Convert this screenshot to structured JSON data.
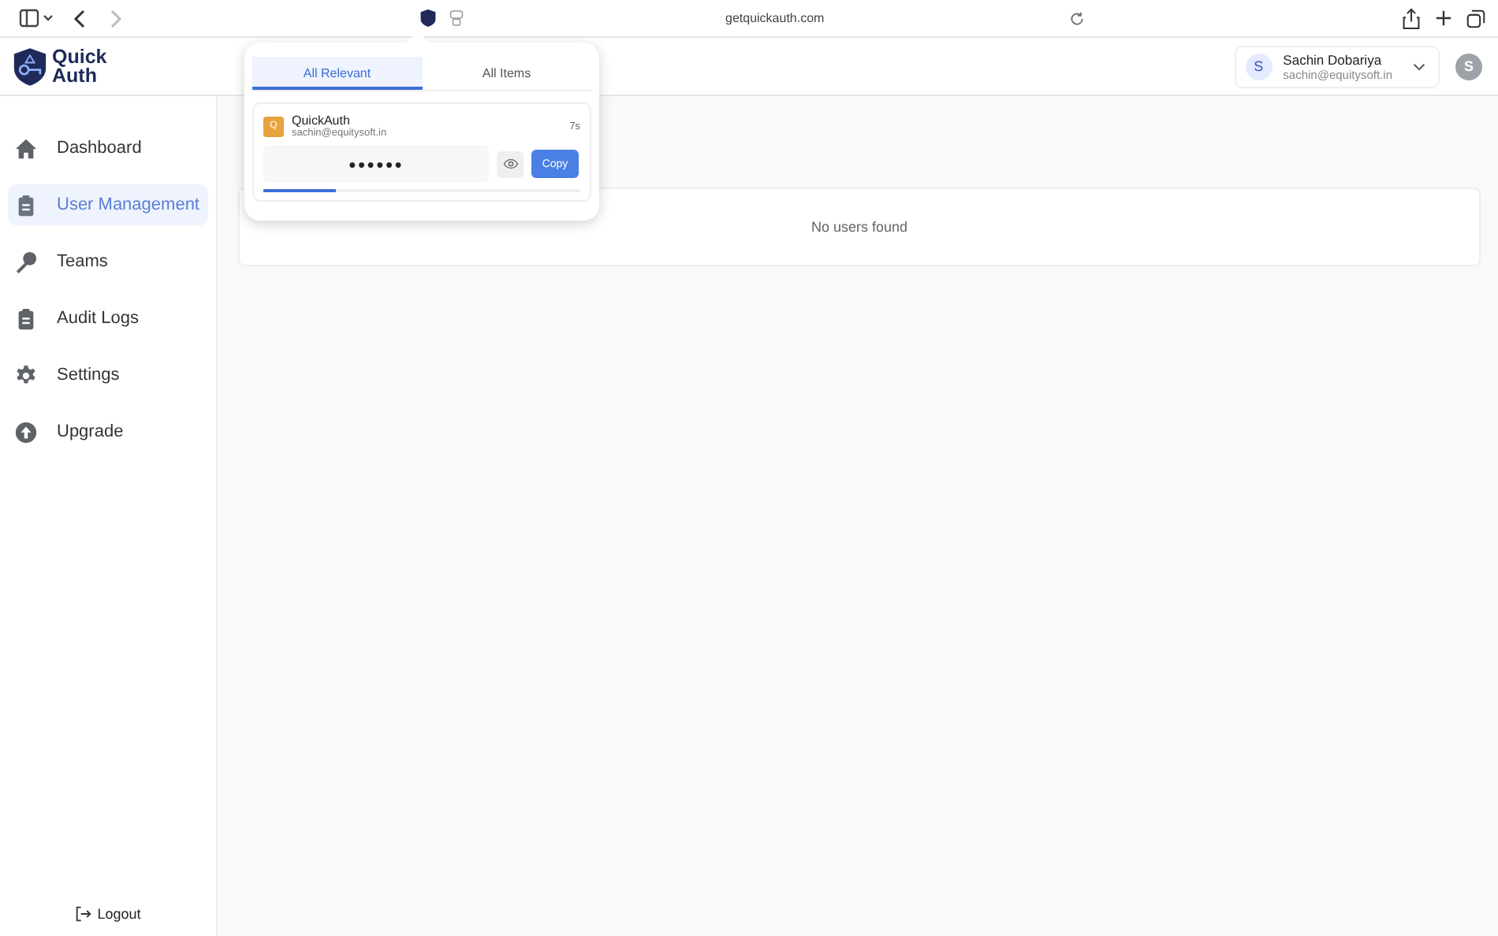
{
  "browser": {
    "url": "getquickauth.com"
  },
  "app": {
    "logo": "Quick\nAuth",
    "user": {
      "initial": "S",
      "name": "Sachin Dobariya",
      "email": "sachin@equitysoft.in"
    },
    "avatar": "S"
  },
  "sidebar": {
    "items": [
      {
        "label": "Dashboard",
        "selected": false
      },
      {
        "label": "User Management",
        "selected": true
      },
      {
        "label": "Teams",
        "selected": false
      },
      {
        "label": "Audit Logs",
        "selected": false
      },
      {
        "label": "Settings",
        "selected": false
      },
      {
        "label": "Upgrade",
        "selected": false
      }
    ],
    "logout": "Logout"
  },
  "page": {
    "empty": "No users found"
  },
  "popup": {
    "tabs": [
      {
        "label": "All Relevant",
        "selected": true
      },
      {
        "label": "All Items",
        "selected": false
      }
    ],
    "entry": {
      "badge": "Q",
      "name": "QuickAuth",
      "email": "sachin@equitysoft.in",
      "timer": "7s",
      "code": "●●●●●●",
      "copy": "Copy",
      "level": 0.23
    }
  }
}
